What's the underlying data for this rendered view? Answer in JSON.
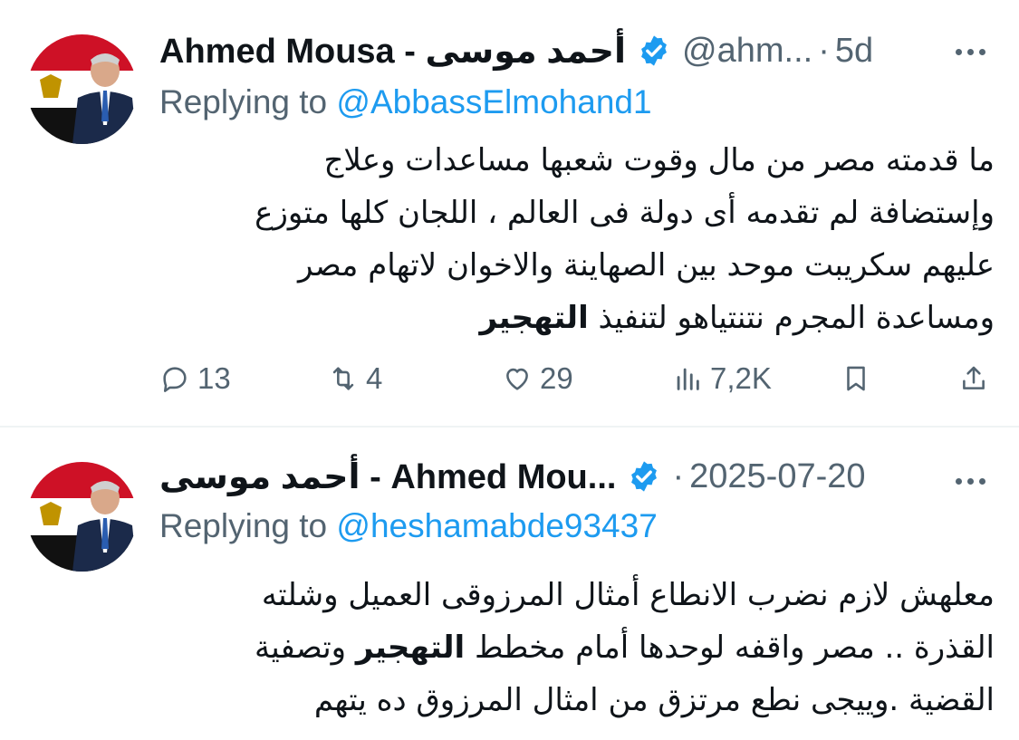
{
  "tweets": [
    {
      "display_name": "Ahmed Mousa - أحمد موسى",
      "handle": "@ahm...",
      "separator": "·",
      "time": "5d",
      "replying_prefix": "Replying to ",
      "replying_to": "@AbbassElmohand1",
      "body_lines": [
        "ما قدمته مصر من مال وقوت شعبها مساعدات وعلاج",
        "وإستضافة لم تقدمه أى دولة فى العالم ، اللجان كلها متوزع",
        "عليهم سكريبت موحد بين الصهاينة والاخوان لاتهام مصر",
        "ومساعدة المجرم نتنتياهو لتنفيذ"
      ],
      "body_bold": "التهجير",
      "stats": {
        "replies": "13",
        "reposts": "4",
        "likes": "29",
        "views": "7,2K"
      }
    },
    {
      "display_name": "...Ahmed Mou - أحمد موسى",
      "separator": "·",
      "time": "2025-07-20",
      "replying_prefix": "Replying to ",
      "replying_to": "@heshamabde93437",
      "body_line1": "معلهش لازم نضرب الانطاع أمثال المرزوقى العميل وشلته",
      "body_line2_pre": "القذرة .. مصر واقفه لوحدها أمام مخطط",
      "body_line2_bold": "التهجير",
      "body_line2_post": "وتصفية",
      "body_line3": "القضية .وييجى نطع مرتزق من امثال المرزوق  ده يتهم"
    }
  ],
  "colors": {
    "accent": "#1d9bf0",
    "secondary_text": "#536471",
    "divider": "#eff3f4"
  },
  "icons": [
    "verified-badge-icon",
    "more-icon",
    "reply-icon",
    "repost-icon",
    "like-icon",
    "views-icon",
    "bookmark-icon",
    "share-icon"
  ]
}
